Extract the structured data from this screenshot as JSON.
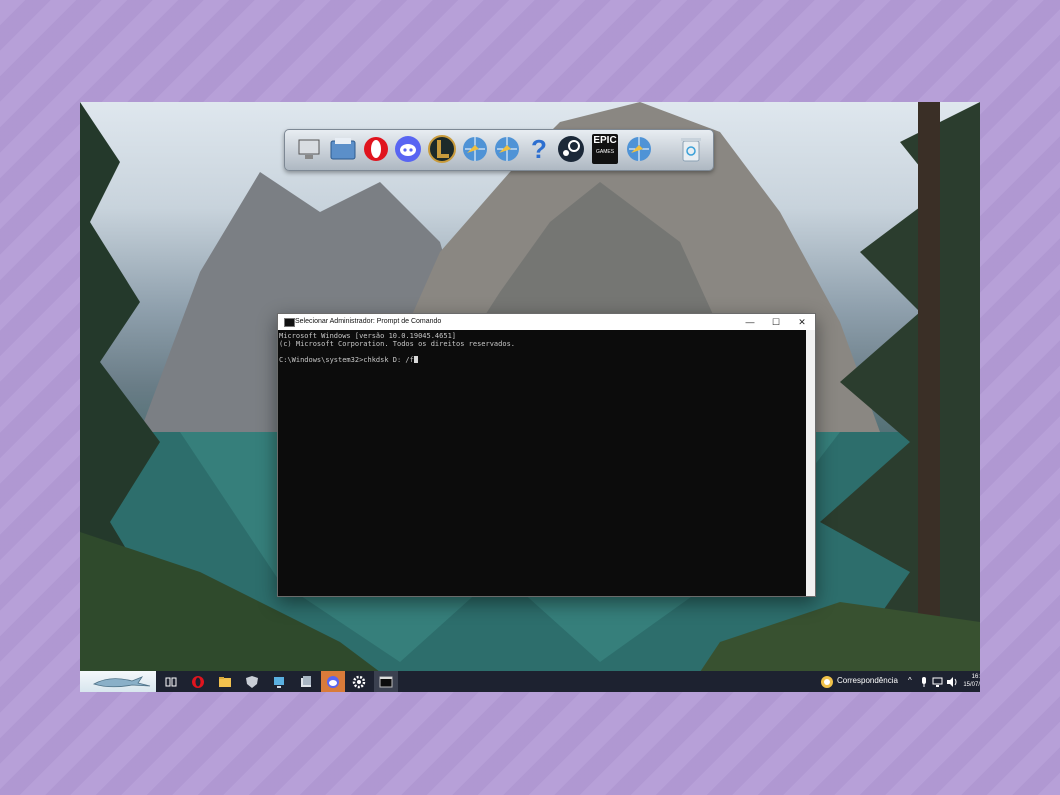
{
  "cmd_window": {
    "title": "Selecionar Administrador: Prompt de Comando",
    "minimize": "—",
    "maximize": "☐",
    "close": "✕",
    "lines": [
      "Microsoft Windows [versão 10.0.19045.4651]",
      "(c) Microsoft Corporation. Todos os direitos reservados.",
      "",
      "C:\\Windows\\system32>chkdsk D: /f"
    ]
  },
  "dock": {
    "epic_label_top": "EPIC",
    "epic_label_bottom": "GAMES",
    "help_glyph": "?"
  },
  "taskbar": {
    "notification_label": "Correspondência",
    "tray_chevron": "^",
    "clock_time": "16:",
    "clock_date": "15/07/"
  },
  "colors": {
    "terminal_bg": "#0c0c0c",
    "terminal_text": "#c8c8c8",
    "taskbar_bg": "#1d2230",
    "frame_bg": "#b39bd6"
  }
}
